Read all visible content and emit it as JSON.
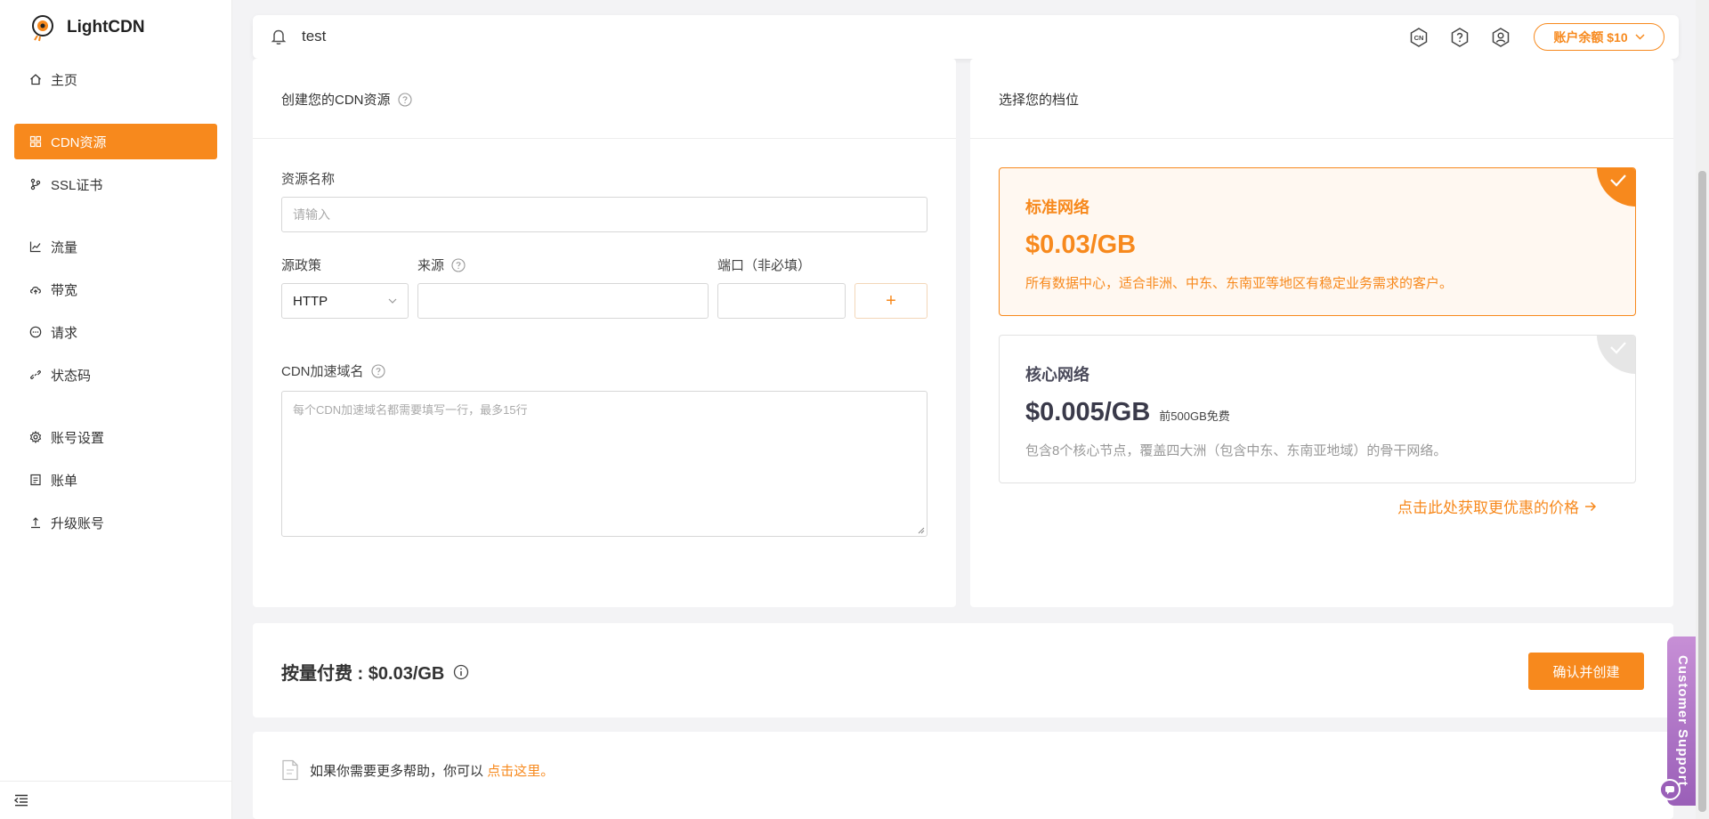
{
  "brand": {
    "name": "LightCDN",
    "accent": "#f7891d"
  },
  "sidebar": {
    "items": [
      {
        "label": "主页",
        "icon": "home-icon"
      },
      {
        "label": "CDN资源",
        "icon": "grid-icon",
        "active": true
      },
      {
        "label": "SSL证书",
        "icon": "branch-icon"
      },
      {
        "label": "流量",
        "icon": "line-chart-icon"
      },
      {
        "label": "带宽",
        "icon": "cloud-icon"
      },
      {
        "label": "请求",
        "icon": "message-icon"
      },
      {
        "label": "状态码",
        "icon": "link-icon"
      },
      {
        "label": "账号设置",
        "icon": "gear-icon"
      },
      {
        "label": "账单",
        "icon": "receipt-icon"
      },
      {
        "label": "升级账号",
        "icon": "upgrade-icon"
      }
    ]
  },
  "header": {
    "username": "test",
    "balance_label": "账户余额 $10"
  },
  "create_panel": {
    "title": "创建您的CDN资源",
    "resource_name_label": "资源名称",
    "resource_name_placeholder": "请输入",
    "origin_policy_label": "源政策",
    "origin_policy_value": "HTTP",
    "origin_label": "来源",
    "port_label": "端口（非必填）",
    "add_label": "+",
    "domain_label": "CDN加速域名",
    "domain_placeholder": "每个CDN加速域名都需要填写一行，最多15行"
  },
  "plan_panel": {
    "title": "选择您的档位",
    "plans": [
      {
        "name": "标准网络",
        "price": "$0.03/GB",
        "note": "",
        "desc": "所有数据中心，适合非洲、中东、东南亚等地区有稳定业务需求的客户。",
        "selected": true
      },
      {
        "name": "核心网络",
        "price": "$0.005/GB",
        "note": "前500GB免费",
        "desc": "包含8个核心节点，覆盖四大洲（包含中东、东南亚地域）的骨干网络。",
        "selected": false
      }
    ],
    "promo_link": "点击此处获取更优惠的价格"
  },
  "payment": {
    "text": "按量付费 : $0.03/GB",
    "confirm_label": "确认并创建"
  },
  "help": {
    "text": "如果你需要更多帮助，你可以",
    "link": "点击这里。"
  },
  "support": {
    "label": "Customer Support"
  }
}
